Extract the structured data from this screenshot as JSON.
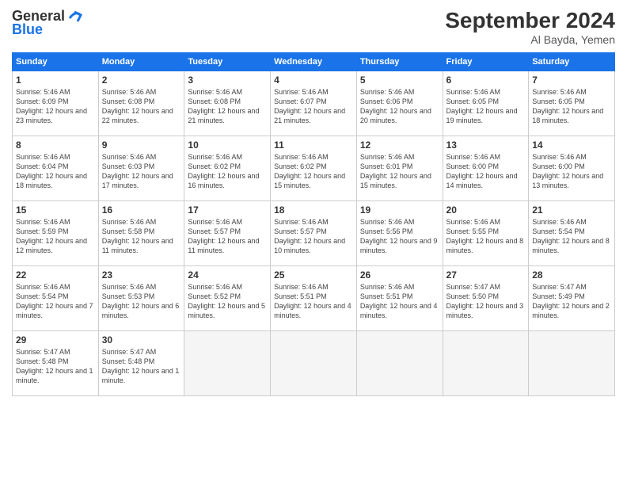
{
  "header": {
    "logo_general": "General",
    "logo_blue": "Blue",
    "month_year": "September 2024",
    "location": "Al Bayda, Yemen"
  },
  "days_of_week": [
    "Sunday",
    "Monday",
    "Tuesday",
    "Wednesday",
    "Thursday",
    "Friday",
    "Saturday"
  ],
  "weeks": [
    [
      {
        "day": "1",
        "sunrise": "5:46 AM",
        "sunset": "6:09 PM",
        "daylight": "12 hours and 23 minutes."
      },
      {
        "day": "2",
        "sunrise": "5:46 AM",
        "sunset": "6:08 PM",
        "daylight": "12 hours and 22 minutes."
      },
      {
        "day": "3",
        "sunrise": "5:46 AM",
        "sunset": "6:08 PM",
        "daylight": "12 hours and 21 minutes."
      },
      {
        "day": "4",
        "sunrise": "5:46 AM",
        "sunset": "6:07 PM",
        "daylight": "12 hours and 21 minutes."
      },
      {
        "day": "5",
        "sunrise": "5:46 AM",
        "sunset": "6:06 PM",
        "daylight": "12 hours and 20 minutes."
      },
      {
        "day": "6",
        "sunrise": "5:46 AM",
        "sunset": "6:05 PM",
        "daylight": "12 hours and 19 minutes."
      },
      {
        "day": "7",
        "sunrise": "5:46 AM",
        "sunset": "6:05 PM",
        "daylight": "12 hours and 18 minutes."
      }
    ],
    [
      {
        "day": "8",
        "sunrise": "5:46 AM",
        "sunset": "6:04 PM",
        "daylight": "12 hours and 18 minutes."
      },
      {
        "day": "9",
        "sunrise": "5:46 AM",
        "sunset": "6:03 PM",
        "daylight": "12 hours and 17 minutes."
      },
      {
        "day": "10",
        "sunrise": "5:46 AM",
        "sunset": "6:02 PM",
        "daylight": "12 hours and 16 minutes."
      },
      {
        "day": "11",
        "sunrise": "5:46 AM",
        "sunset": "6:02 PM",
        "daylight": "12 hours and 15 minutes."
      },
      {
        "day": "12",
        "sunrise": "5:46 AM",
        "sunset": "6:01 PM",
        "daylight": "12 hours and 15 minutes."
      },
      {
        "day": "13",
        "sunrise": "5:46 AM",
        "sunset": "6:00 PM",
        "daylight": "12 hours and 14 minutes."
      },
      {
        "day": "14",
        "sunrise": "5:46 AM",
        "sunset": "6:00 PM",
        "daylight": "12 hours and 13 minutes."
      }
    ],
    [
      {
        "day": "15",
        "sunrise": "5:46 AM",
        "sunset": "5:59 PM",
        "daylight": "12 hours and 12 minutes."
      },
      {
        "day": "16",
        "sunrise": "5:46 AM",
        "sunset": "5:58 PM",
        "daylight": "12 hours and 11 minutes."
      },
      {
        "day": "17",
        "sunrise": "5:46 AM",
        "sunset": "5:57 PM",
        "daylight": "12 hours and 11 minutes."
      },
      {
        "day": "18",
        "sunrise": "5:46 AM",
        "sunset": "5:57 PM",
        "daylight": "12 hours and 10 minutes."
      },
      {
        "day": "19",
        "sunrise": "5:46 AM",
        "sunset": "5:56 PM",
        "daylight": "12 hours and 9 minutes."
      },
      {
        "day": "20",
        "sunrise": "5:46 AM",
        "sunset": "5:55 PM",
        "daylight": "12 hours and 8 minutes."
      },
      {
        "day": "21",
        "sunrise": "5:46 AM",
        "sunset": "5:54 PM",
        "daylight": "12 hours and 8 minutes."
      }
    ],
    [
      {
        "day": "22",
        "sunrise": "5:46 AM",
        "sunset": "5:54 PM",
        "daylight": "12 hours and 7 minutes."
      },
      {
        "day": "23",
        "sunrise": "5:46 AM",
        "sunset": "5:53 PM",
        "daylight": "12 hours and 6 minutes."
      },
      {
        "day": "24",
        "sunrise": "5:46 AM",
        "sunset": "5:52 PM",
        "daylight": "12 hours and 5 minutes."
      },
      {
        "day": "25",
        "sunrise": "5:46 AM",
        "sunset": "5:51 PM",
        "daylight": "12 hours and 4 minutes."
      },
      {
        "day": "26",
        "sunrise": "5:46 AM",
        "sunset": "5:51 PM",
        "daylight": "12 hours and 4 minutes."
      },
      {
        "day": "27",
        "sunrise": "5:47 AM",
        "sunset": "5:50 PM",
        "daylight": "12 hours and 3 minutes."
      },
      {
        "day": "28",
        "sunrise": "5:47 AM",
        "sunset": "5:49 PM",
        "daylight": "12 hours and 2 minutes."
      }
    ],
    [
      {
        "day": "29",
        "sunrise": "5:47 AM",
        "sunset": "5:48 PM",
        "daylight": "12 hours and 1 minute."
      },
      {
        "day": "30",
        "sunrise": "5:47 AM",
        "sunset": "5:48 PM",
        "daylight": "12 hours and 1 minute."
      },
      null,
      null,
      null,
      null,
      null
    ]
  ]
}
